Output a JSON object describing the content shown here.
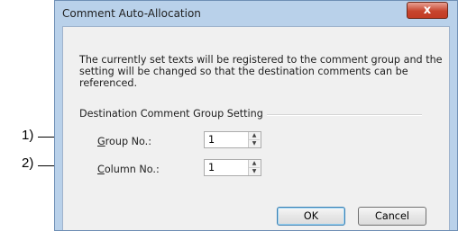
{
  "callouts": [
    {
      "label": "1)"
    },
    {
      "label": "2)"
    }
  ],
  "dialog": {
    "title": "Comment Auto-Allocation",
    "close_label": "x",
    "description": "The currently set texts will be registered to the comment group and the setting will be changed so that the destination comments can be referenced.",
    "group_title": "Destination Comment Group Setting",
    "group_no": {
      "mnemonic": "G",
      "label_rest": "roup No.:",
      "value": "1"
    },
    "column_no": {
      "mnemonic": "C",
      "label_rest": "olumn No.:",
      "value": "1"
    },
    "ok_label": "OK",
    "cancel_label": "Cancel"
  }
}
